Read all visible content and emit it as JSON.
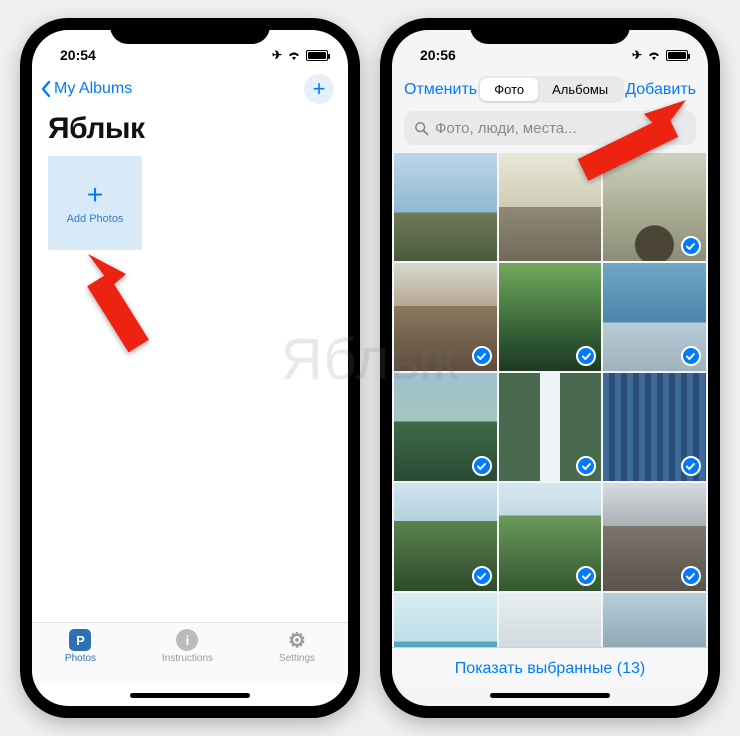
{
  "left": {
    "status_time": "20:54",
    "back_label": "My Albums",
    "album_title": "Яблык",
    "add_photos_label": "Add Photos",
    "tabs": [
      {
        "icon": "P",
        "label": "Photos"
      },
      {
        "icon": "i",
        "label": "Instructions"
      },
      {
        "icon": "⚙",
        "label": "Settings"
      }
    ]
  },
  "right": {
    "status_time": "20:56",
    "cancel_label": "Отменить",
    "segment": {
      "photos": "Фото",
      "albums": "Альбомы"
    },
    "add_label": "Добавить",
    "search_placeholder": "Фото, люди, места...",
    "thumbs": [
      {
        "cls": "sky1",
        "selected": false
      },
      {
        "cls": "bldg1",
        "selected": false
      },
      {
        "cls": "arch",
        "selected": true
      },
      {
        "cls": "ruin",
        "selected": true
      },
      {
        "cls": "green",
        "selected": true
      },
      {
        "cls": "statue",
        "selected": true
      },
      {
        "cls": "mtn",
        "selected": true
      },
      {
        "cls": "wfall",
        "selected": true
      },
      {
        "cls": "hotel",
        "selected": true
      },
      {
        "cls": "hill1",
        "selected": true
      },
      {
        "cls": "hill2",
        "selected": true
      },
      {
        "cls": "city",
        "selected": true
      },
      {
        "cls": "lake",
        "selected": true
      },
      {
        "cls": "fog",
        "selected": true
      },
      {
        "cls": "car",
        "selected": true
      }
    ],
    "footer_label": "Показать выбранные (13)",
    "selected_count": 13
  },
  "watermark": "Яблык"
}
